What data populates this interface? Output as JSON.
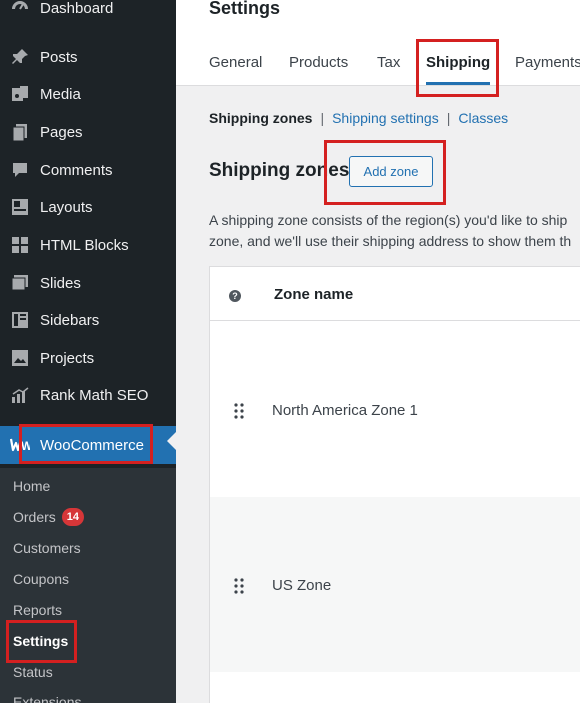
{
  "sidebar": {
    "items": [
      {
        "label": "Dashboard",
        "icon": "dashboard-icon"
      },
      {
        "label": "Posts",
        "icon": "pin-icon"
      },
      {
        "label": "Media",
        "icon": "media-icon"
      },
      {
        "label": "Pages",
        "icon": "pages-icon"
      },
      {
        "label": "Comments",
        "icon": "comment-icon"
      },
      {
        "label": "Layouts",
        "icon": "layouts-icon"
      },
      {
        "label": "HTML Blocks",
        "icon": "html-blocks-icon"
      },
      {
        "label": "Slides",
        "icon": "slides-icon"
      },
      {
        "label": "Sidebars",
        "icon": "sidebars-icon"
      },
      {
        "label": "Projects",
        "icon": "projects-icon"
      },
      {
        "label": "Rank Math SEO",
        "icon": "rank-math-icon"
      }
    ],
    "woocommerce": {
      "label": "WooCommerce",
      "icon": "woocommerce-icon"
    },
    "submenu": [
      {
        "label": "Home"
      },
      {
        "label": "Orders",
        "badge": "14"
      },
      {
        "label": "Customers"
      },
      {
        "label": "Coupons"
      },
      {
        "label": "Reports"
      },
      {
        "label": "Settings"
      },
      {
        "label": "Status"
      },
      {
        "label": "Extensions"
      }
    ]
  },
  "header": {
    "title": "Settings",
    "tabs": [
      {
        "label": "General"
      },
      {
        "label": "Products"
      },
      {
        "label": "Tax"
      },
      {
        "label": "Shipping"
      },
      {
        "label": "Payments"
      }
    ]
  },
  "subnav": {
    "current": "Shipping zones",
    "links": [
      "Shipping settings",
      "Classes"
    ],
    "separator": "|"
  },
  "zones": {
    "heading": "Shipping zones",
    "add_button": "Add zone",
    "description_line1": "A shipping zone consists of the region(s) you'd like to ship",
    "description_line2": "zone, and we'll use their shipping address to show them th",
    "table": {
      "help_icon": "?",
      "column_zone_name": "Zone name",
      "rows": [
        {
          "name": "North America Zone 1"
        },
        {
          "name": "US Zone"
        }
      ]
    }
  },
  "colors": {
    "sidebar_bg": "#1d2327",
    "submenu_bg": "#2c3338",
    "accent": "#2271b1",
    "highlight": "#d42020",
    "badge": "#d63638"
  }
}
